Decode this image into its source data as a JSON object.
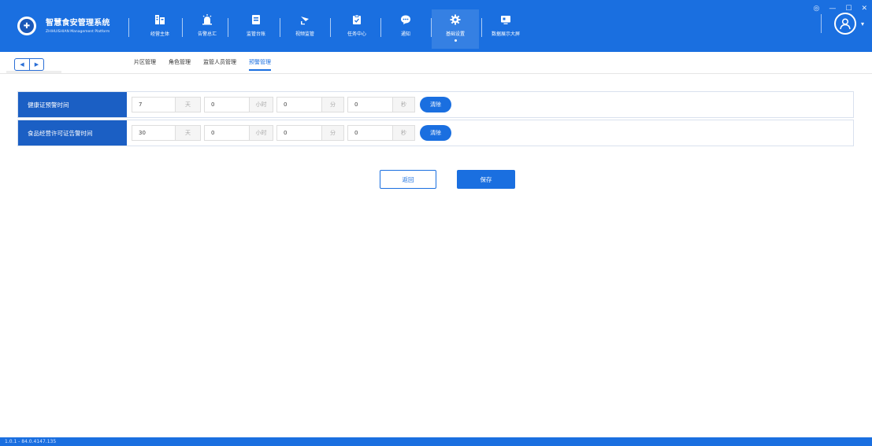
{
  "app": {
    "title": "智慧食安管理系统",
    "subtitle": "ZHIHUISHIAN Management Platform",
    "window_controls": [
      "◎",
      "—",
      "☐",
      "✕"
    ]
  },
  "nav": [
    {
      "label": "经营主体",
      "icon": "building-icon"
    },
    {
      "label": "告警总汇",
      "icon": "alarm-icon"
    },
    {
      "label": "监管台账",
      "icon": "ledger-icon"
    },
    {
      "label": "视频监管",
      "icon": "camera-icon"
    },
    {
      "label": "任务中心",
      "icon": "clipboard-icon"
    },
    {
      "label": "通知",
      "icon": "chat-icon"
    },
    {
      "label": "基础设置",
      "icon": "gear-icon",
      "active": true
    },
    {
      "label": "数据展示大屏",
      "icon": "monitor-icon"
    }
  ],
  "subnav": {
    "tabs": [
      "片区管理",
      "角色管理",
      "监管人员管理",
      "预警管理"
    ],
    "active_tab": "预警管理"
  },
  "form": {
    "rows": [
      {
        "label": "健康证预警时间",
        "day": "7",
        "hour": "0",
        "minute": "0",
        "second": "0"
      },
      {
        "label": "食品经营许可证告警时间",
        "day": "30",
        "hour": "0",
        "minute": "0",
        "second": "0"
      }
    ],
    "units": {
      "day": "天",
      "hour": "小时",
      "minute": "分",
      "second": "秒"
    },
    "clear_label": "清除"
  },
  "actions": {
    "back_label": "返回",
    "save_label": "保存"
  },
  "status": {
    "version": "1.0.1 - 84.0.4147.135"
  },
  "colors": {
    "primary": "#1a6fe0",
    "label_bg": "#1b5fc4"
  }
}
